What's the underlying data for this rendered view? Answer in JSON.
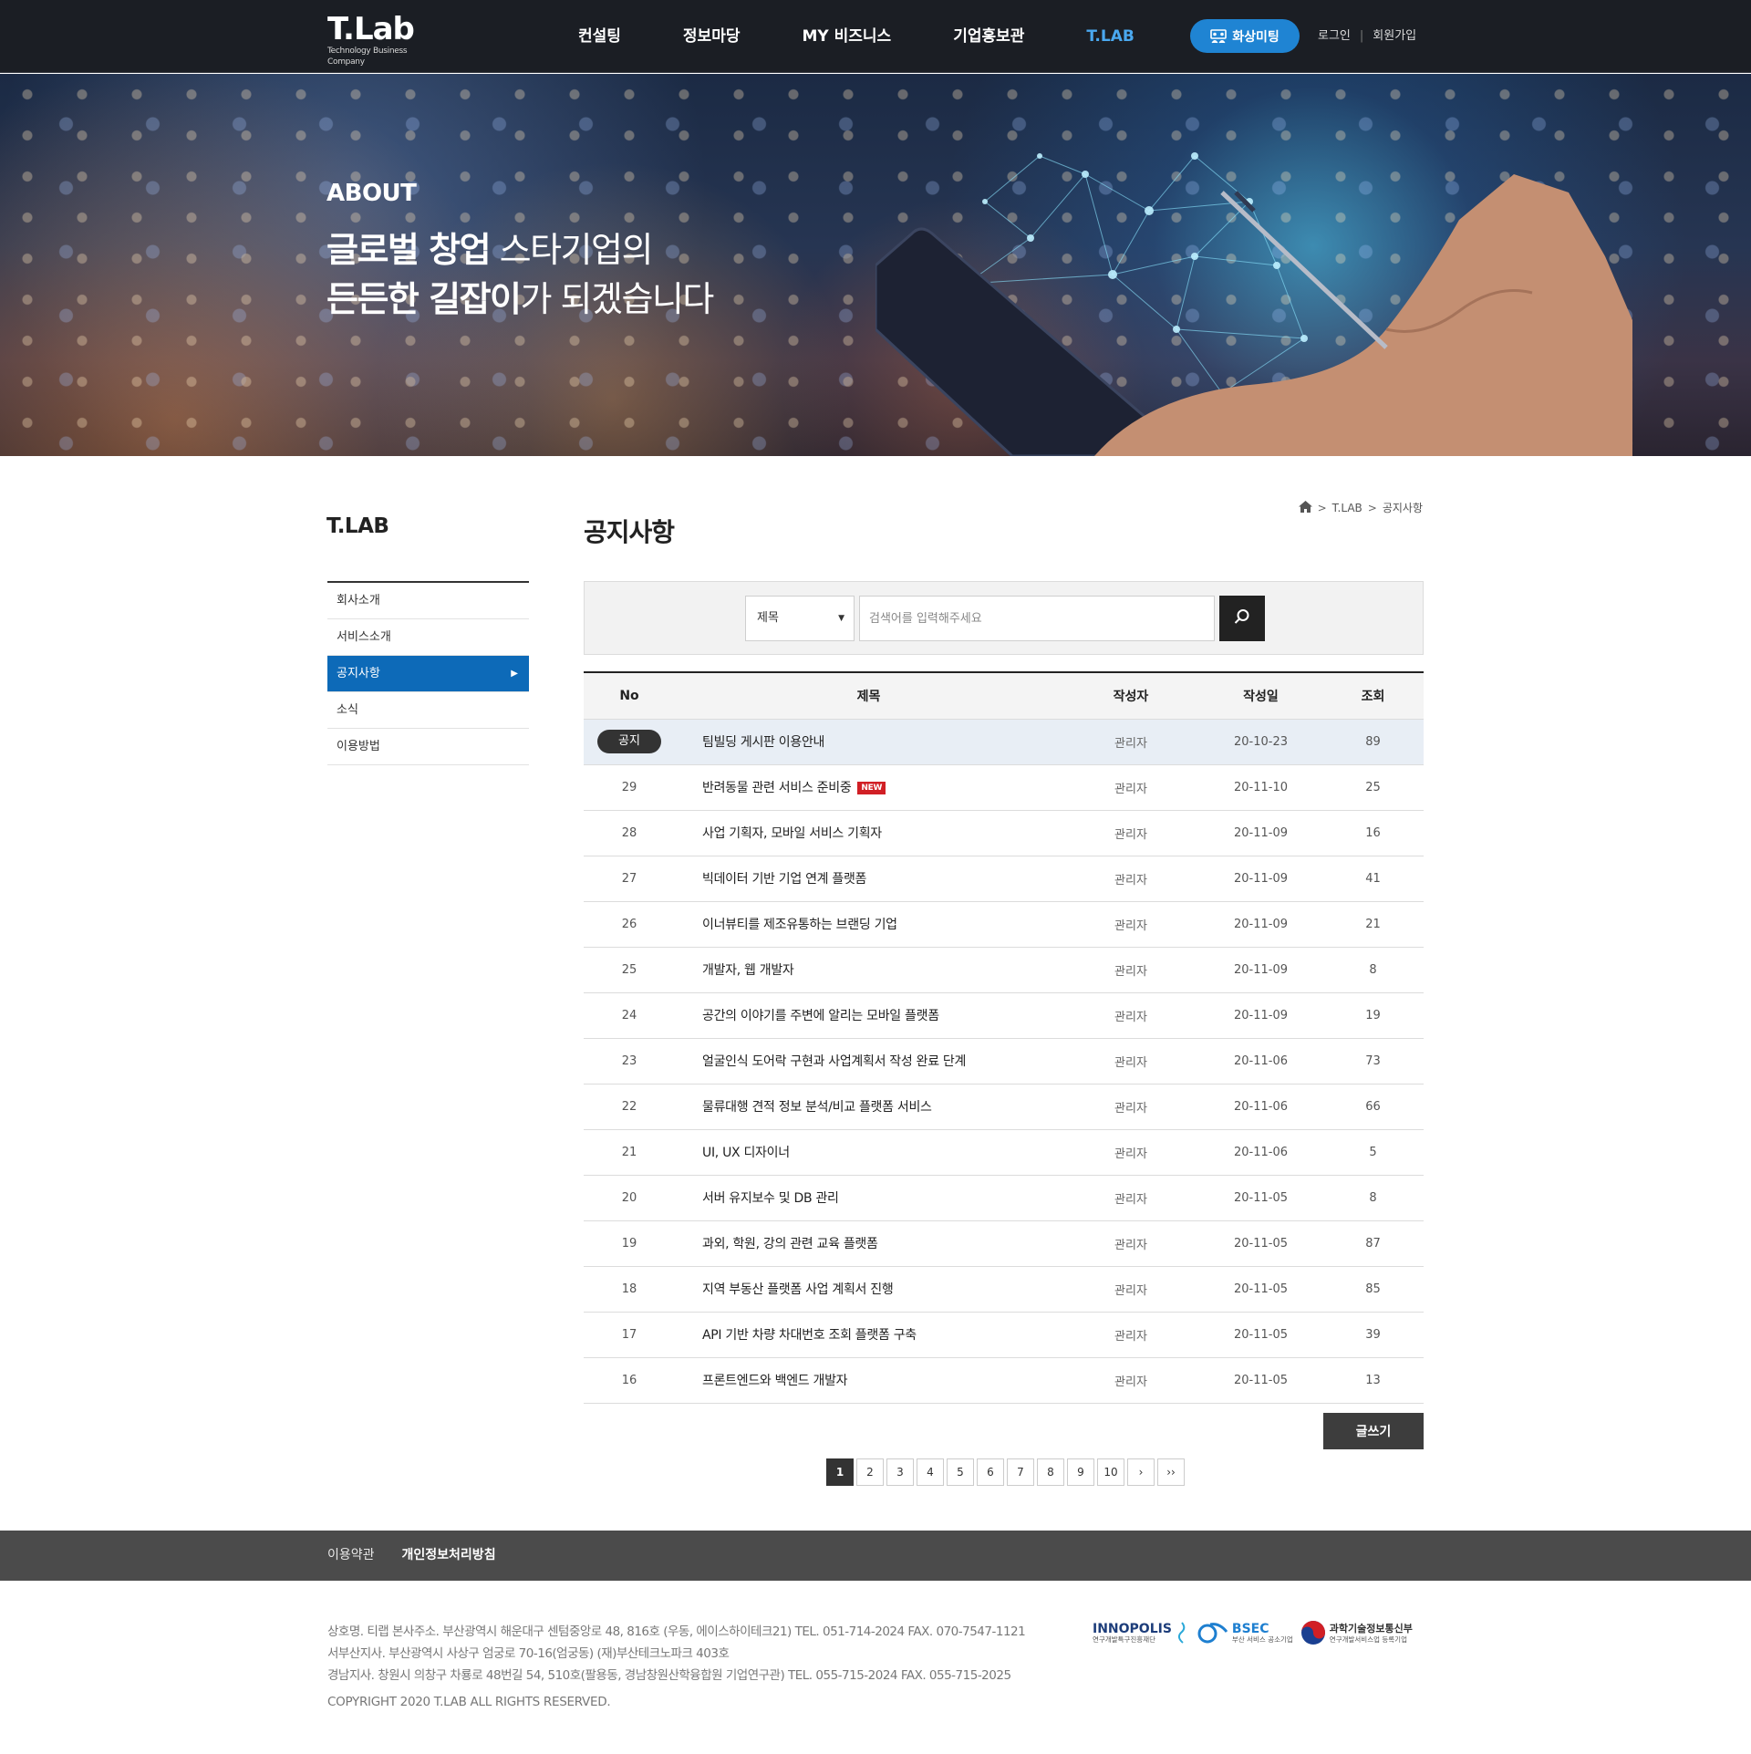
{
  "header": {
    "logo_main": "T.Lab",
    "logo_sub": "Technology Business Company",
    "nav": [
      "컨설팅",
      "정보마당",
      "MY 비즈니스",
      "기업홍보관",
      "T.LAB"
    ],
    "meeting_label": "화상미팅",
    "login": "로그인",
    "signup": "회원가입",
    "accent_color": "#1f84d3"
  },
  "hero": {
    "eyebrow": "ABOUT",
    "line1_bold": "글로벌 창업",
    "line1_rest": " 스타기업의",
    "line2_bold": "든든한 길잡이",
    "line2_rest": "가 되겠습니다"
  },
  "sidebar": {
    "title": "T.LAB",
    "items": [
      "회사소개",
      "서비스소개",
      "공지사항",
      "소식",
      "이용방법"
    ],
    "active_index": 2,
    "active_color": "#0d6ab8"
  },
  "breadcrumb": {
    "home_icon": "home-icon",
    "items": [
      "T.LAB",
      "공지사항"
    ]
  },
  "page": {
    "title": "공지사항"
  },
  "search": {
    "select_value": "제목",
    "placeholder": "검색어를 입력해주세요",
    "button_icon": "search-icon"
  },
  "board": {
    "headers": [
      "No",
      "제목",
      "작성자",
      "작성일",
      "조회"
    ],
    "notice": {
      "badge": "공지",
      "title": "팀빌딩 게시판 이용안내",
      "author": "관리자",
      "date": "20-10-23",
      "views": "89"
    },
    "rows": [
      {
        "no": "29",
        "title": "반려동물 관련 서비스 준비중",
        "new": "NEW",
        "author": "관리자",
        "date": "20-11-10",
        "views": "25"
      },
      {
        "no": "28",
        "title": "사업 기획자, 모바일 서비스 기획자",
        "author": "관리자",
        "date": "20-11-09",
        "views": "16"
      },
      {
        "no": "27",
        "title": "빅데이터 기반 기업 연계 플랫폼",
        "author": "관리자",
        "date": "20-11-09",
        "views": "41"
      },
      {
        "no": "26",
        "title": "이너뷰티를 제조유통하는 브랜딩 기업",
        "author": "관리자",
        "date": "20-11-09",
        "views": "21"
      },
      {
        "no": "25",
        "title": "개발자, 웹 개발자",
        "author": "관리자",
        "date": "20-11-09",
        "views": "8"
      },
      {
        "no": "24",
        "title": "공간의 이야기를 주변에 알리는 모바일 플랫폼",
        "author": "관리자",
        "date": "20-11-09",
        "views": "19"
      },
      {
        "no": "23",
        "title": "얼굴인식 도어락 구현과 사업계획서 작성 완료 단계",
        "author": "관리자",
        "date": "20-11-06",
        "views": "73"
      },
      {
        "no": "22",
        "title": "물류대행 견적 정보 분석/비교 플랫폼 서비스",
        "author": "관리자",
        "date": "20-11-06",
        "views": "66"
      },
      {
        "no": "21",
        "title": "UI, UX 디자이너",
        "author": "관리자",
        "date": "20-11-06",
        "views": "5"
      },
      {
        "no": "20",
        "title": "서버 유지보수 및 DB 관리",
        "author": "관리자",
        "date": "20-11-05",
        "views": "8"
      },
      {
        "no": "19",
        "title": "과외, 학원, 강의 관련 교육 플랫폼",
        "author": "관리자",
        "date": "20-11-05",
        "views": "87"
      },
      {
        "no": "18",
        "title": "지역 부동산 플랫폼 사업 계획서 진행",
        "author": "관리자",
        "date": "20-11-05",
        "views": "85"
      },
      {
        "no": "17",
        "title": "API 기반 차량 차대번호 조회 플랫폼 구축",
        "author": "관리자",
        "date": "20-11-05",
        "views": "39"
      },
      {
        "no": "16",
        "title": "프론트엔드와 백엔드 개발자",
        "author": "관리자",
        "date": "20-11-05",
        "views": "13"
      }
    ],
    "write_label": "글쓰기"
  },
  "pagination": {
    "pages": [
      "1",
      "2",
      "3",
      "4",
      "5",
      "6",
      "7",
      "8",
      "9",
      "10"
    ],
    "current": "1",
    "next": "›",
    "last": "››"
  },
  "footer": {
    "links": [
      "이용약관",
      "개인정보처리방침"
    ],
    "info_lines": [
      "상호명. 티랩   본사주소. 부산광역시 해운대구 센텀중앙로 48, 816호 (우동, 에이스하이테크21)   TEL. 051-714-2024   FAX. 070-7547-1121",
      "서부산지사. 부산광역시 사상구 엄궁로 70-16(엄궁동) (재)부산테크노파크 403호",
      "경남지사. 창원시 의창구 차룡로 48번길 54, 510호(팔용동, 경남창원산학융합원 기업연구관)   TEL. 055-715-2024   FAX. 055-715-2025"
    ],
    "copyright": "COPYRIGHT 2020 T.LAB ALL RIGHTS RESERVED.",
    "partner_logos": [
      {
        "name": "INNOPOLIS",
        "sub": "연구개발특구진흥재단"
      },
      {
        "name": "BSEC",
        "sub": "부산 서비스 공소기업"
      },
      {
        "name": "과학기술정보통신부",
        "sub": "연구개발서비스업 등록기업"
      }
    ]
  }
}
